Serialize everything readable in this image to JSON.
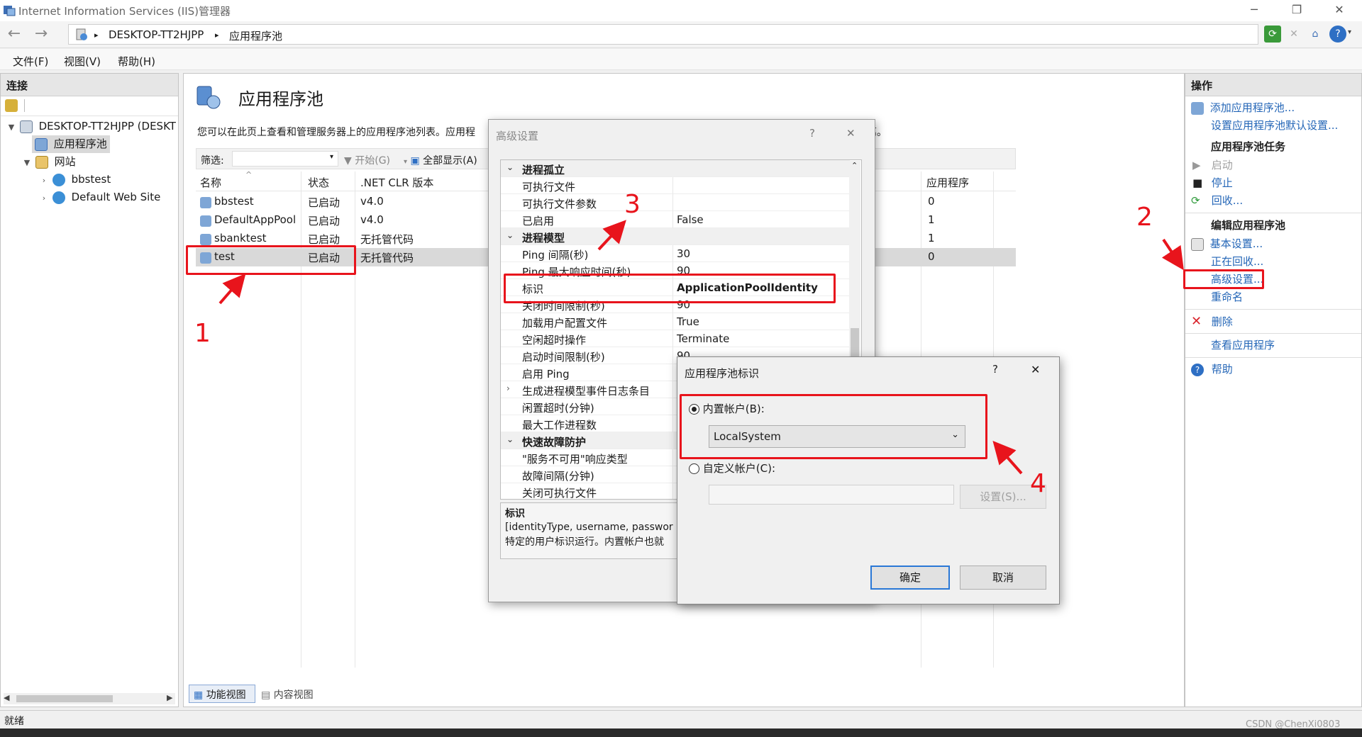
{
  "window": {
    "title": "Internet Information Services (IIS)管理器",
    "minimize": "─",
    "restore": "❐",
    "close": "✕"
  },
  "address": {
    "back": "←",
    "forward": "→",
    "crumbs": [
      "DESKTOP-TT2HJPP",
      "应用程序池"
    ],
    "separator": "▸"
  },
  "menu": [
    "文件(F)",
    "视图(V)",
    "帮助(H)"
  ],
  "connections": {
    "title": "连接",
    "tree": {
      "server": "DESKTOP-TT2HJPP (DESKT",
      "app_pools": "应用程序池",
      "sites": "网站",
      "site1": "bbstest",
      "site2": "Default Web Site"
    }
  },
  "center": {
    "title": "应用程序池",
    "description": "您可以在此页上查看和管理服务器上的应用程序池列表。应用程",
    "description_tail": "离。",
    "filter_label": "筛选:",
    "start_label": "开始(G)",
    "show_all_label": "全部显示(A)",
    "columns": {
      "name": "名称",
      "status": "状态",
      "clr": ".NET CLR 版本",
      "apps": "应用程序"
    },
    "rows": [
      {
        "name": "bbstest",
        "status": "已启动",
        "clr": "v4.0",
        "apps": "0"
      },
      {
        "name": "DefaultAppPool",
        "status": "已启动",
        "clr": "v4.0",
        "apps": "1"
      },
      {
        "name": "sbanktest",
        "status": "已启动",
        "clr": "无托管代码",
        "apps": "1"
      },
      {
        "name": "test",
        "status": "已启动",
        "clr": "无托管代码",
        "apps": "0"
      }
    ],
    "tab_features": "功能视图",
    "tab_content": "内容视图"
  },
  "actions": {
    "title": "操作",
    "add_pool": "添加应用程序池...",
    "set_defaults": "设置应用程序池默认设置...",
    "tasks_header": "应用程序池任务",
    "start": "启动",
    "stop": "停止",
    "recycle": "回收...",
    "edit_header": "编辑应用程序池",
    "basic": "基本设置...",
    "recycling": "正在回收...",
    "advanced": "高级设置...",
    "rename": "重命名",
    "delete": "删除",
    "view_apps": "查看应用程序",
    "help": "帮助"
  },
  "advanced_dialog": {
    "title": "高级设置",
    "help": "?",
    "close": "✕",
    "rows": [
      {
        "key": "进程孤立",
        "value": "",
        "cat": true,
        "exp": "⌄"
      },
      {
        "key": "可执行文件",
        "value": ""
      },
      {
        "key": "可执行文件参数",
        "value": ""
      },
      {
        "key": "已启用",
        "value": "False"
      },
      {
        "key": "进程模型",
        "value": "",
        "cat": true,
        "exp": "⌄"
      },
      {
        "key": "Ping 间隔(秒)",
        "value": "30"
      },
      {
        "key": "Ping 最大响应时间(秒)",
        "value": "90"
      },
      {
        "key": "标识",
        "value": "ApplicationPoolIdentity",
        "bold": true
      },
      {
        "key": "关闭时间限制(秒)",
        "value": "90"
      },
      {
        "key": "加载用户配置文件",
        "value": "True"
      },
      {
        "key": "空闲超时操作",
        "value": "Terminate"
      },
      {
        "key": "启动时间限制(秒)",
        "value": "90"
      },
      {
        "key": "启用 Ping",
        "value": ""
      },
      {
        "key": "生成进程模型事件日志条目",
        "value": "",
        "exp": "›"
      },
      {
        "key": "闲置超时(分钟)",
        "value": ""
      },
      {
        "key": "最大工作进程数",
        "value": ""
      },
      {
        "key": "快速故障防护",
        "value": "",
        "cat": true,
        "exp": "⌄"
      },
      {
        "key": "\"服务不可用\"响应类型",
        "value": ""
      },
      {
        "key": "故障间隔(分钟)",
        "value": ""
      },
      {
        "key": "关闭可执行文件",
        "value": ""
      }
    ],
    "desc_title": "标识",
    "desc_line1": "[identityType, username, passwor",
    "desc_line2": "特定的用户标识运行。内置帐户也就"
  },
  "identity_dialog": {
    "title": "应用程序池标识",
    "help": "?",
    "close": "✕",
    "builtin_label": "内置帐户(B):",
    "builtin_value": "LocalSystem",
    "custom_label": "自定义帐户(C):",
    "custom_value": "",
    "set_button": "设置(S)...",
    "ok": "确定",
    "cancel": "取消"
  },
  "annotations": [
    "1",
    "2",
    "3",
    "4"
  ],
  "status": {
    "text": "就绪",
    "watermark": "CSDN @ChenXi0803"
  },
  "colors": {
    "accent_link": "#2466b7",
    "annotation_red": "#e8141c",
    "selected_row": "#d9d9d9"
  }
}
